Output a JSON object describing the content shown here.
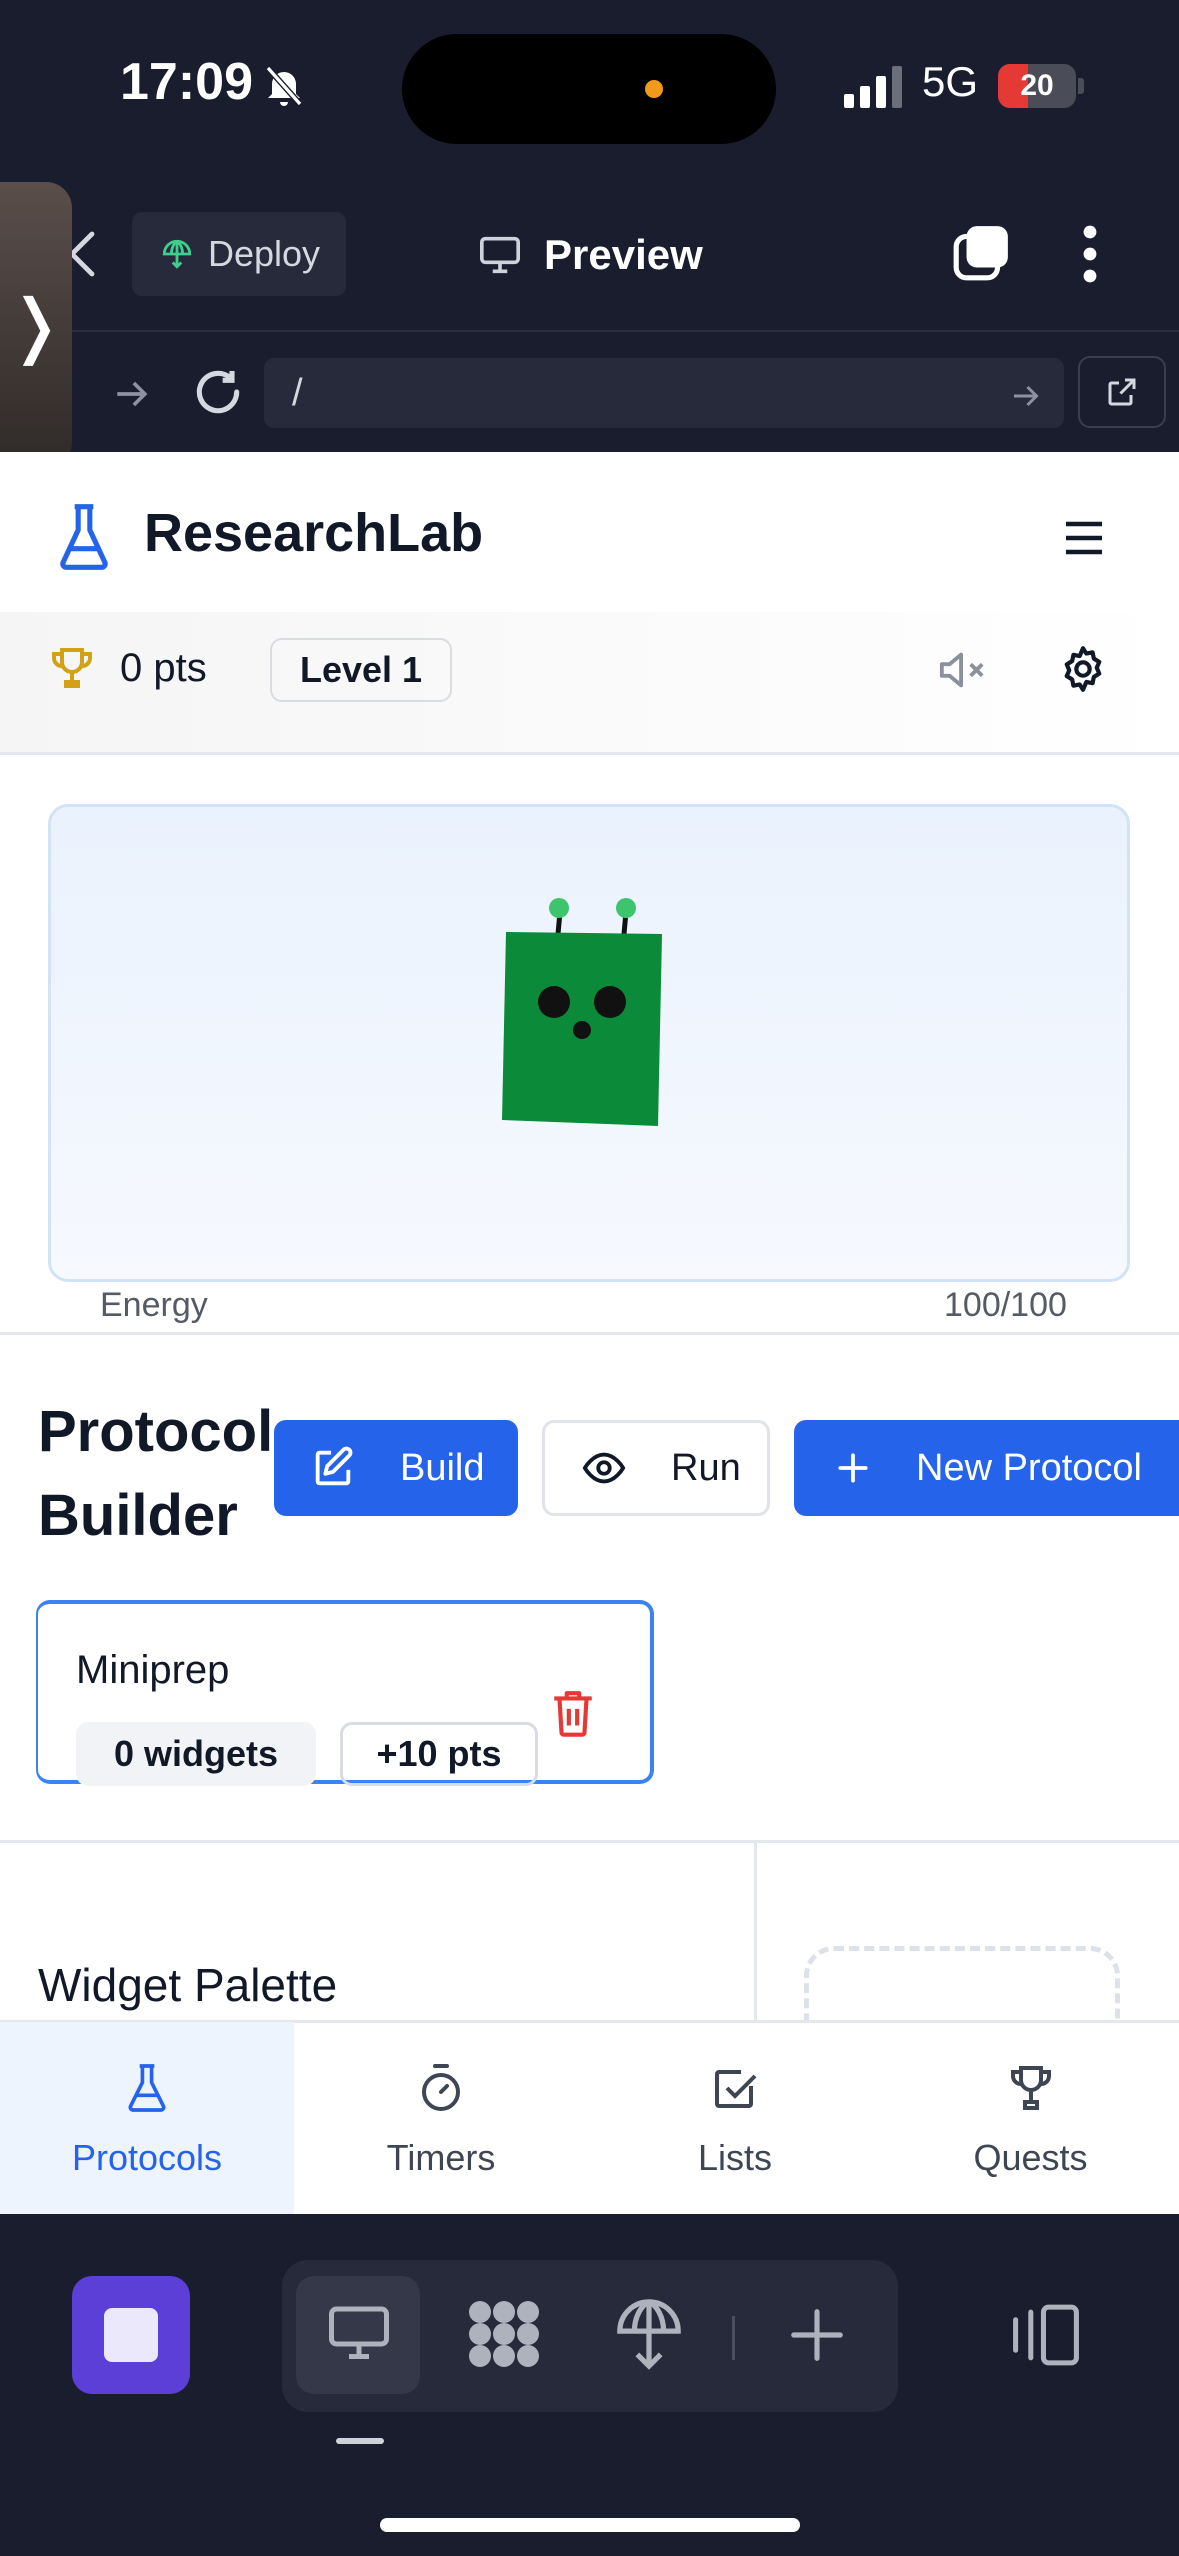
{
  "status_bar": {
    "time": "17:09",
    "network": "5G",
    "battery": "20"
  },
  "browser": {
    "deploy_label": "Deploy",
    "preview_label": "Preview",
    "url": "/",
    "side_tab_glyph": "❭"
  },
  "app": {
    "brand": "ResearchLab",
    "points": "0 pts",
    "level": "Level 1",
    "energy_label": "Energy",
    "energy_value": "100/100",
    "energy_level": 1.0
  },
  "protocol_builder": {
    "title": "Protocol Builder",
    "build_label": "Build",
    "run_label": "Run",
    "new_label": "New Protocol",
    "cards": [
      {
        "name": "Miniprep",
        "widgets": "0 widgets",
        "reward": "+10 pts"
      }
    ]
  },
  "palette": {
    "title": "Widget Palette"
  },
  "bottom_nav": [
    {
      "label": "Protocols",
      "icon": "flask-icon",
      "active": true
    },
    {
      "label": "Timers",
      "icon": "stopwatch-icon",
      "active": false
    },
    {
      "label": "Lists",
      "icon": "checkbox-icon",
      "active": false
    },
    {
      "label": "Quests",
      "icon": "trophy-icon",
      "active": false
    }
  ],
  "colors": {
    "accent": "#2563eb",
    "chrome": "#1a1d2e",
    "creature": "#0b8a3a",
    "danger": "#e53935"
  }
}
